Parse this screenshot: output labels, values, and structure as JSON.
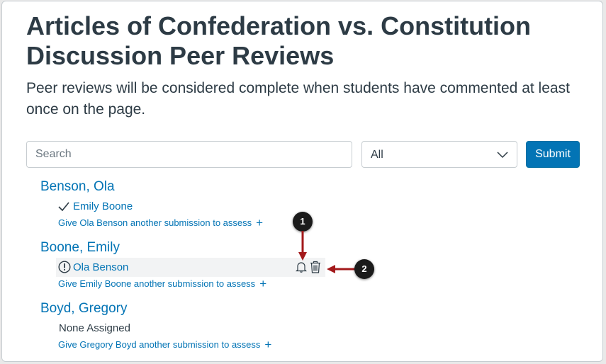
{
  "page": {
    "title": "Articles of Confederation vs. Constitution Discussion Peer Reviews",
    "description": "Peer reviews will be considered complete when students have commented at least once on the page."
  },
  "filters": {
    "search_placeholder": "Search",
    "select_value": "All",
    "submit_label": "Submit"
  },
  "students": [
    {
      "name": "Benson, Ola",
      "reviewer": "Emily Boone",
      "reviewer_status": "complete",
      "add_link": "Give Ola Benson another submission to assess"
    },
    {
      "name": "Boone, Emily",
      "reviewer": "Ola Benson",
      "reviewer_status": "incomplete",
      "add_link": "Give Emily Boone another submission to assess"
    },
    {
      "name": "Boyd, Gregory",
      "none_text": "None Assigned",
      "add_link": "Give Gregory Boyd another submission to assess"
    }
  ],
  "callouts": [
    "1",
    "2"
  ],
  "colors": {
    "link": "#0374b5",
    "text": "#2d3b45",
    "button": "#0374b5",
    "arrow": "#a3191b",
    "callout": "#1b1b1b"
  }
}
